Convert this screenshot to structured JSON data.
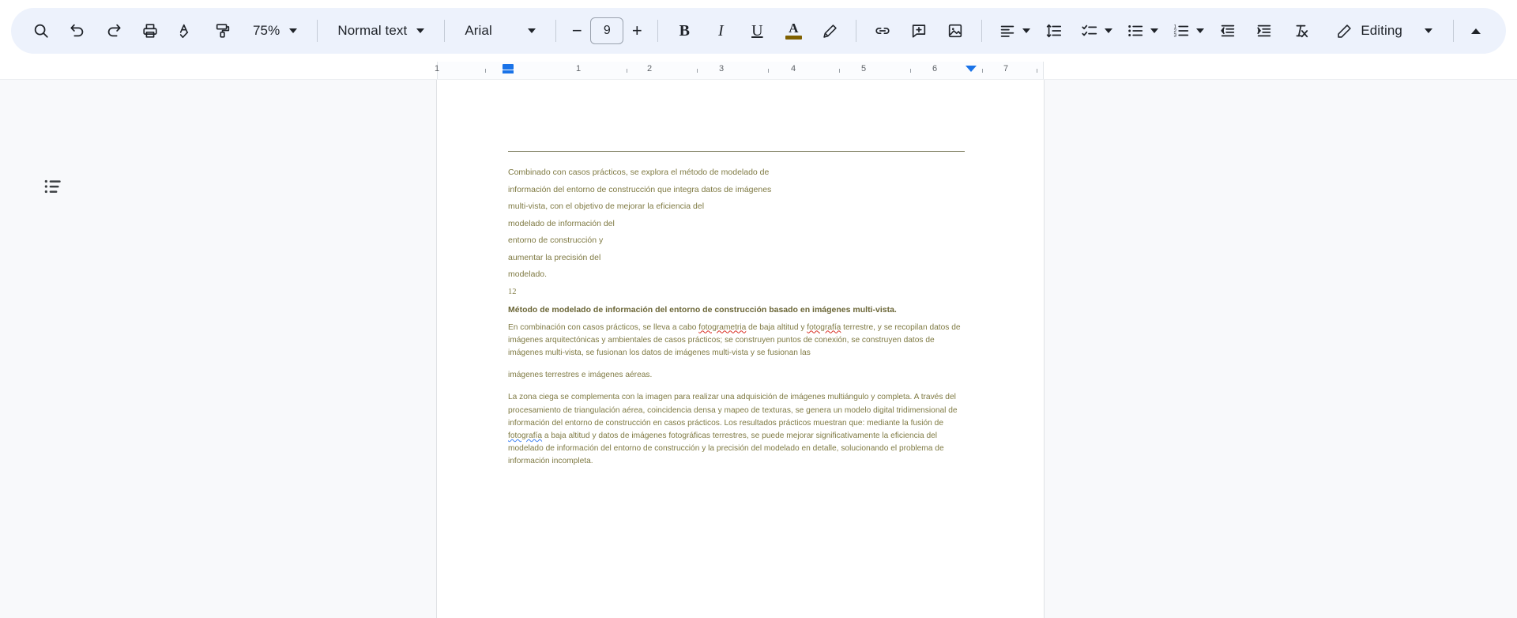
{
  "toolbar": {
    "search_label": "search-icon",
    "undo_label": "undo-icon",
    "redo_label": "redo-icon",
    "print_label": "print-icon",
    "spellcheck_label": "spellcheck-icon",
    "paint_format_label": "paint-format-icon",
    "zoom_value": "75%",
    "style_value": "Normal text",
    "font_value": "Arial",
    "font_size_value": "9",
    "decrease_font_label": "−",
    "increase_font_label": "+",
    "bold_label": "B",
    "italic_label": "I",
    "underline_label": "U",
    "text_color_label": "A",
    "text_color_hex": "#7f6000",
    "highlight_label": "highlight-icon",
    "link_label": "insert-link-icon",
    "comment_label": "add-comment-icon",
    "image_label": "insert-image-icon",
    "align_label": "align-left-icon",
    "line_spacing_label": "line-spacing-icon",
    "checklist_label": "checklist-icon",
    "bulleted_list_label": "bulleted-list-icon",
    "numbered_list_label": "numbered-list-icon",
    "decrease_indent_label": "decrease-indent-icon",
    "increase_indent_label": "increase-indent-icon",
    "clear_formatting_label": "clear-formatting-icon",
    "mode_label": "Editing",
    "collapse_label": "collapse-toolbar-icon",
    "accent_hex": "#1a73e8",
    "toolbar_bg_hex": "#edf2fc"
  },
  "ruler": {
    "marks": [
      "1",
      "1",
      "2",
      "3",
      "4",
      "5",
      "6",
      "7"
    ],
    "left_indent_label": "left-indent-marker",
    "right_indent_label": "right-indent-marker"
  },
  "sidebar": {
    "outline_label": "document-outline-icon"
  },
  "document": {
    "loose_paragraph_lines": [
      "Combinado con casos prácticos, se explora el método de modelado de",
      "información del entorno de construcción que integra datos de imágenes",
      "multi-vista, con el objetivo de mejorar la eficiencia del",
      "modelado de información del",
      "entorno de construcción y",
      "aumentar la precisión del",
      "modelado."
    ],
    "page_number": "12",
    "heading": "Método de modelado de información del entorno de construcción basado en imágenes multi-vista.",
    "paragraph_2": {
      "part1": "En combinación con casos prácticos, se lleva a cabo ",
      "misspelled1": "fotogrametria",
      "part2": " de baja altitud y ",
      "misspelled2": "fotografía",
      "part3": " terrestre, y se recopilan datos de imágenes arquitectónicas y ambientales de casos prácticos; se construyen puntos de conexión, se construyen datos de imágenes multi-vista, se fusionan los datos de imágenes multi-vista y se fusionan las"
    },
    "paragraph_2b": "imágenes terrestres e imágenes aéreas.",
    "paragraph_3": {
      "part1": "La zona ciega se complementa con la imagen para realizar una adquisición de imágenes multiángulo y completa. A través del procesamiento de triangulación aérea, coincidencia densa y mapeo de texturas, se genera un modelo digital tridimensional de información del entorno de construcción en casos prácticos. Los resultados prácticos muestran que: mediante la fusión de ",
      "misspelled1": "fotografía",
      "part2": " a baja altitud y datos de imágenes fotográficas terrestres, se puede mejorar significativamente la eficiencia del modelado de información del entorno de construcción y la precisión del modelado en detalle, solucionando el problema de información incompleta."
    },
    "text_color_hex": "#7f7a43"
  }
}
